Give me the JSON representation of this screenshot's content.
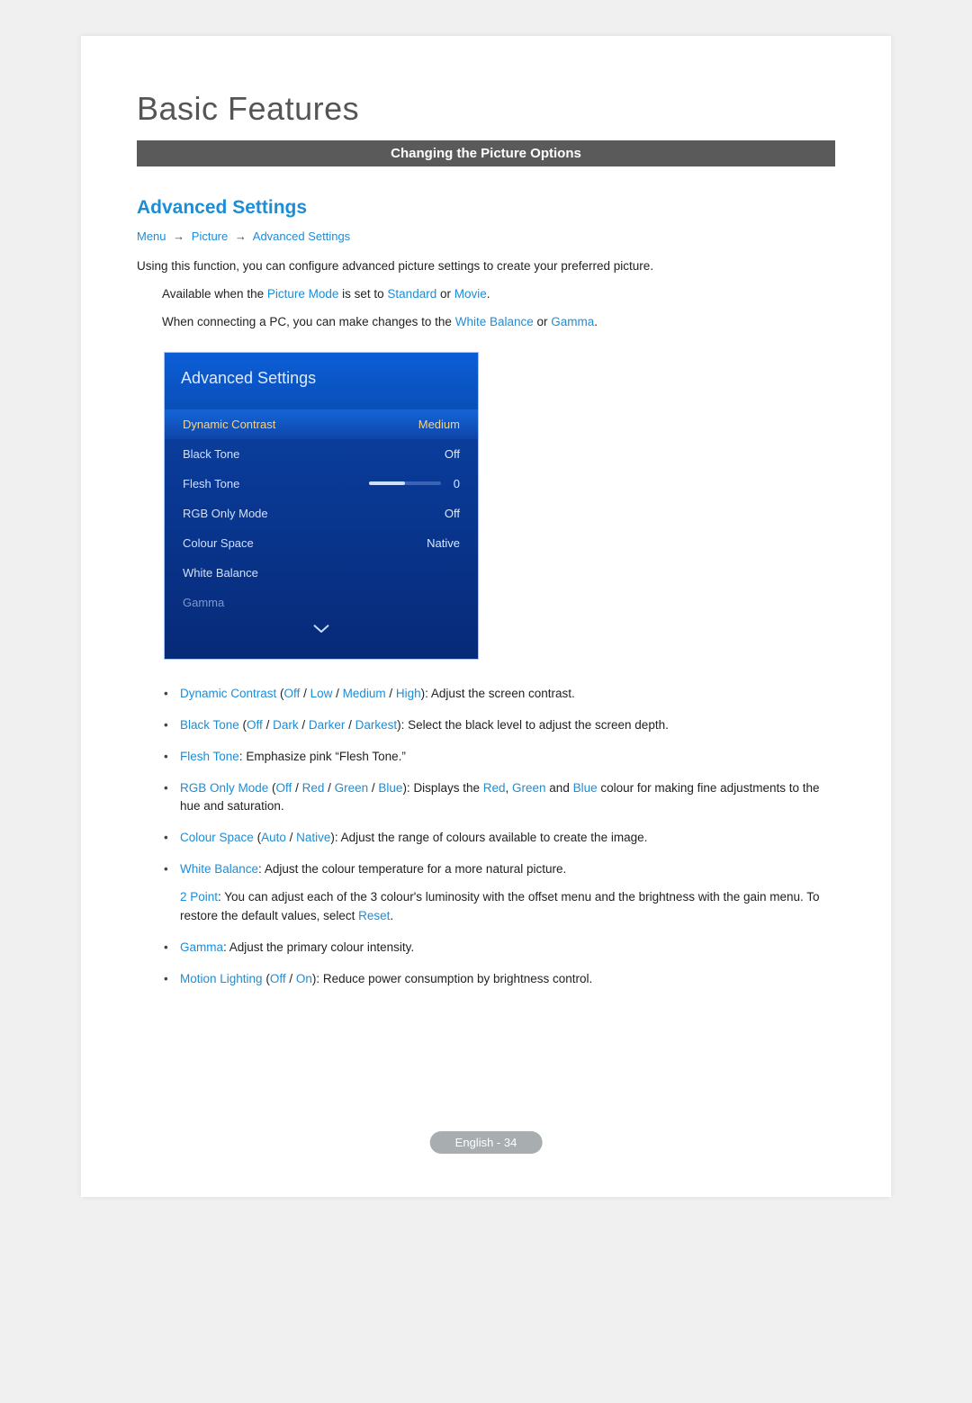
{
  "page_title": "Basic Features",
  "section_bar": "Changing the Picture Options",
  "heading": "Advanced Settings",
  "breadcrumbs": {
    "a": "Menu",
    "b": "Picture",
    "c": "Advanced Settings"
  },
  "intro": "Using this function, you can configure advanced picture settings to create your preferred picture.",
  "note1_pre": "Available when the ",
  "note1_pm": "Picture Mode",
  "note1_mid": " is set to ",
  "note1_std": "Standard",
  "note1_or": " or ",
  "note1_mov": "Movie",
  "note1_post": ".",
  "note2_pre": "When connecting a PC, you can make changes to the ",
  "note2_wb": "White Balance",
  "note2_or": " or ",
  "note2_g": "Gamma",
  "note2_post": ".",
  "osd": {
    "title": "Advanced Settings",
    "rows": [
      {
        "label": "Dynamic Contrast",
        "value": "Medium",
        "selected": true
      },
      {
        "label": "Black Tone",
        "value": "Off"
      },
      {
        "label": "Flesh Tone",
        "value": "0",
        "slider": true
      },
      {
        "label": "RGB Only Mode",
        "value": "Off"
      },
      {
        "label": "Colour Space",
        "value": "Native"
      },
      {
        "label": "White Balance",
        "value": ""
      },
      {
        "label": "Gamma",
        "value": "",
        "dim": true
      }
    ]
  },
  "bullet1": {
    "name": "Dynamic Contrast",
    "opts": [
      "Off",
      "Low",
      "Medium",
      "High"
    ],
    "desc": "Adjust the screen contrast."
  },
  "bullet2": {
    "name": "Black Tone",
    "opts": [
      "Off",
      "Dark",
      "Darker",
      "Darkest"
    ],
    "desc": "Select the black level to adjust the screen depth."
  },
  "bullet3": {
    "name": "Flesh Tone",
    "desc": "Emphasize pink “Flesh Tone.”"
  },
  "bullet4": {
    "name": "RGB Only Mode",
    "opts": [
      "Off",
      "Red",
      "Green",
      "Blue"
    ],
    "pre": "Displays the ",
    "r": "Red",
    "c": ", ",
    "g": "Green",
    "a": " and ",
    "b": "Blue",
    "post": " colour for making fine adjustments to the hue and saturation."
  },
  "bullet5": {
    "name": "Colour Space",
    "opts": [
      "Auto",
      "Native"
    ],
    "desc": "Adjust the range of colours available to create the image."
  },
  "bullet6": {
    "name": "White Balance",
    "desc": "Adjust the colour temperature for a more natural picture.",
    "sub_name": "2 Point",
    "sub_pre": ": You can adjust each of the 3 colour's luminosity with the offset menu and the brightness with the gain menu. To restore the default values, select ",
    "sub_reset": "Reset",
    "sub_post": "."
  },
  "bullet7": {
    "name": "Gamma",
    "desc": "Adjust the primary colour intensity."
  },
  "bullet8": {
    "name": "Motion Lighting",
    "opts": [
      "Off",
      "On"
    ],
    "desc": "Reduce power consumption by brightness control."
  },
  "footer": "English - 34"
}
